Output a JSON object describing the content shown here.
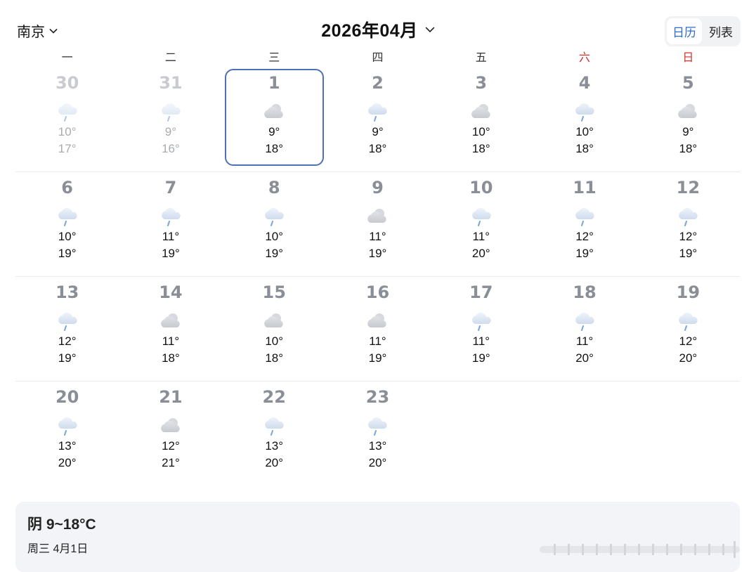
{
  "header": {
    "city": "南京",
    "month_title": "2026年04月",
    "view_options": [
      {
        "label": "日历",
        "active": true
      },
      {
        "label": "列表",
        "active": false
      }
    ]
  },
  "weekdays": [
    {
      "label": "一",
      "weekend": false
    },
    {
      "label": "二",
      "weekend": false
    },
    {
      "label": "三",
      "weekend": false
    },
    {
      "label": "四",
      "weekend": false
    },
    {
      "label": "五",
      "weekend": false
    },
    {
      "label": "六",
      "weekend": true
    },
    {
      "label": "日",
      "weekend": true
    }
  ],
  "weeks": [
    [
      {
        "day": "30",
        "icon": "rain-cloud-icon",
        "low": "10°",
        "high": "17°",
        "other_month": true
      },
      {
        "day": "31",
        "icon": "rain-cloud-icon",
        "low": "9°",
        "high": "16°",
        "other_month": true
      },
      {
        "day": "1",
        "icon": "overcast-cloud-icon",
        "low": "9°",
        "high": "18°",
        "selected": true
      },
      {
        "day": "2",
        "icon": "rain-cloud-icon",
        "low": "9°",
        "high": "18°"
      },
      {
        "day": "3",
        "icon": "overcast-cloud-icon",
        "low": "10°",
        "high": "18°"
      },
      {
        "day": "4",
        "icon": "rain-cloud-icon",
        "low": "10°",
        "high": "18°"
      },
      {
        "day": "5",
        "icon": "overcast-cloud-icon",
        "low": "9°",
        "high": "18°"
      }
    ],
    [
      {
        "day": "6",
        "icon": "rain-cloud-icon",
        "low": "10°",
        "high": "19°"
      },
      {
        "day": "7",
        "icon": "rain-cloud-icon",
        "low": "11°",
        "high": "19°"
      },
      {
        "day": "8",
        "icon": "rain-cloud-icon",
        "low": "10°",
        "high": "19°"
      },
      {
        "day": "9",
        "icon": "overcast-cloud-icon",
        "low": "11°",
        "high": "19°"
      },
      {
        "day": "10",
        "icon": "rain-cloud-icon",
        "low": "11°",
        "high": "20°"
      },
      {
        "day": "11",
        "icon": "rain-cloud-icon",
        "low": "12°",
        "high": "19°"
      },
      {
        "day": "12",
        "icon": "rain-cloud-icon",
        "low": "12°",
        "high": "19°"
      }
    ],
    [
      {
        "day": "13",
        "icon": "rain-cloud-icon",
        "low": "12°",
        "high": "19°"
      },
      {
        "day": "14",
        "icon": "overcast-cloud-icon",
        "low": "11°",
        "high": "18°"
      },
      {
        "day": "15",
        "icon": "overcast-cloud-icon",
        "low": "10°",
        "high": "18°"
      },
      {
        "day": "16",
        "icon": "overcast-cloud-icon",
        "low": "11°",
        "high": "19°"
      },
      {
        "day": "17",
        "icon": "rain-cloud-icon",
        "low": "11°",
        "high": "19°"
      },
      {
        "day": "18",
        "icon": "rain-cloud-icon",
        "low": "11°",
        "high": "20°"
      },
      {
        "day": "19",
        "icon": "rain-cloud-icon",
        "low": "12°",
        "high": "20°"
      }
    ],
    [
      {
        "day": "20",
        "icon": "rain-cloud-icon",
        "low": "13°",
        "high": "20°"
      },
      {
        "day": "21",
        "icon": "overcast-cloud-icon",
        "low": "12°",
        "high": "21°"
      },
      {
        "day": "22",
        "icon": "rain-cloud-icon",
        "low": "13°",
        "high": "20°"
      },
      {
        "day": "23",
        "icon": "rain-cloud-icon",
        "low": "13°",
        "high": "20°"
      },
      null,
      null,
      null
    ]
  ],
  "detail": {
    "summary": "阴 9~18°C",
    "date": "周三 4月1日"
  },
  "colors": {
    "accent": "#2f6bd8",
    "weekend": "#d8312b",
    "selected_border": "#4f6fb8"
  }
}
